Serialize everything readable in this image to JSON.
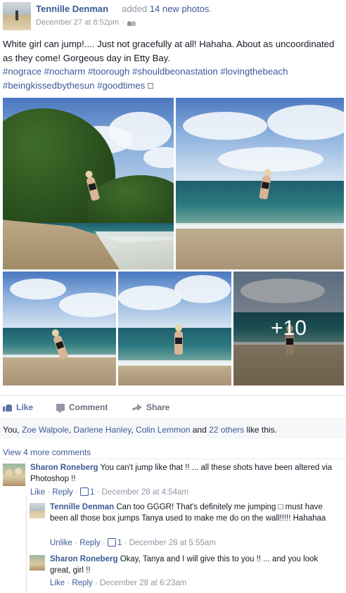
{
  "post": {
    "author": "Tennille Denman",
    "action_prefix": "added",
    "action_count": "14 new photos",
    "action_suffix": ".",
    "timestamp": "December 27 at 8:52pm",
    "audience_icon": "friends-icon",
    "text_main": "White girl can jump!.... Just not gracefully at all! Hahaha. About as uncoordinated as they come! Gorgeous day in Etty Bay.",
    "hashtags": "#nograce #nocharm #toorough #shouldbeonastation #lovingthebeach #beingkissedbythesun #goodtimes",
    "emoji_box": "□"
  },
  "photos": {
    "more_count": "+10"
  },
  "actions": {
    "like": "Like",
    "comment": "Comment",
    "share": "Share"
  },
  "likes": {
    "prefix": "You,",
    "names": [
      "Zoe Walpole",
      "Darlene Hanley",
      "Colin Lemmon"
    ],
    "and": "and",
    "others": "22 others",
    "suffix": "like this."
  },
  "comments": {
    "view_more": "View 4 more comments",
    "items": [
      {
        "name": "Sharon Roneberg",
        "text": "You can't jump like that !! ... all these shots have been altered via Photoshop !!",
        "like_label": "Like",
        "reply_label": "Reply",
        "like_count": "1",
        "time": "December 28 at 4:54am"
      },
      {
        "name": "Tennille Denman",
        "text": "Can too GGGR! That's definitely me jumping □ must have been all those box jumps Tanya used to make me do on the wall!!!!! Hahahaa",
        "like_label": "Unlike",
        "reply_label": "Reply",
        "like_count": "1",
        "time": "December 28 at 5:55am"
      },
      {
        "name": "Sharon Roneberg",
        "text": "Okay, Tanya and I will give this to you !! ... and you look great, girl !!",
        "like_label": "Like",
        "reply_label": "Reply",
        "time": "December 28 at 6:23am"
      }
    ]
  },
  "colors": {
    "link": "#3b5998",
    "meta_grey": "#9197a3",
    "text": "#141823"
  }
}
